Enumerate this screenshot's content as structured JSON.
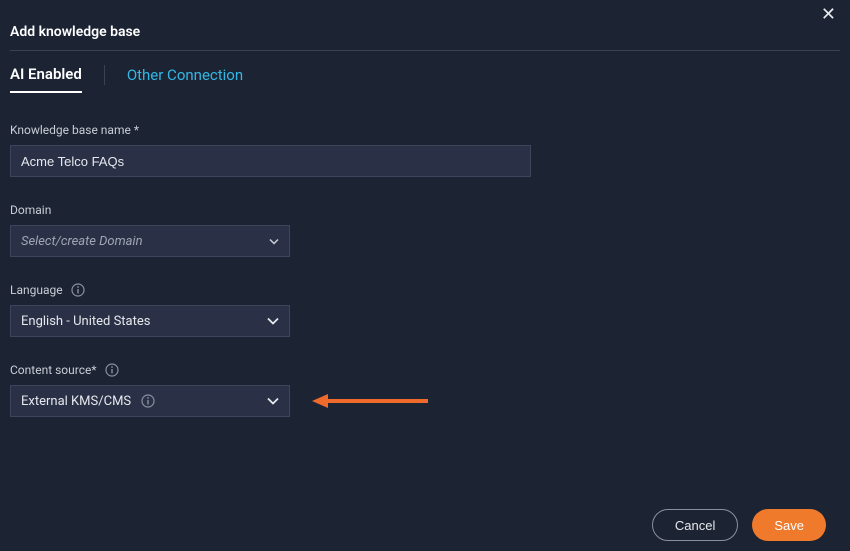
{
  "dialog": {
    "title": "Add knowledge base"
  },
  "tabs": {
    "ai": "AI Enabled",
    "other": "Other Connection"
  },
  "fields": {
    "name": {
      "label": "Knowledge base name *",
      "value": "Acme Telco FAQs"
    },
    "domain": {
      "label": "Domain",
      "placeholder": "Select/create Domain"
    },
    "language": {
      "label": "Language",
      "value": "English - United States"
    },
    "source": {
      "label": "Content source*",
      "value": "External KMS/CMS"
    }
  },
  "buttons": {
    "cancel": "Cancel",
    "save": "Save"
  },
  "colors": {
    "accent": "#f07a2b",
    "link": "#34b7e4",
    "bg": "#1c2333",
    "field": "#2a3147"
  }
}
